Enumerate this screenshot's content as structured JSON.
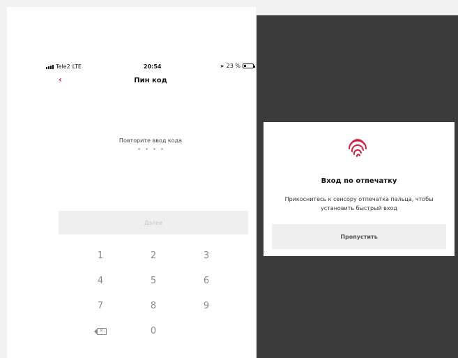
{
  "status": {
    "carrier": "Tele2",
    "network": "LTE",
    "time": "20:54",
    "battery": "23 %",
    "battery_level": 0.23
  },
  "nav": {
    "title": "Пин код"
  },
  "pin": {
    "prompt": "Повторите ввод кода",
    "filled_dots": 4
  },
  "next_button": {
    "label": "Далее"
  },
  "keypad": {
    "keys": [
      "1",
      "2",
      "3",
      "4",
      "5",
      "6",
      "7",
      "8",
      "9",
      "",
      "0",
      ""
    ]
  },
  "modal": {
    "title": "Вход по отпечатку",
    "text": "Прикоснитесь к сенсору отпечатка пальца, чтобы установить быстрый вход",
    "skip_label": "Пропустить"
  },
  "colors": {
    "accent": "#d61f3c",
    "overlay": "#3b3b3b"
  }
}
